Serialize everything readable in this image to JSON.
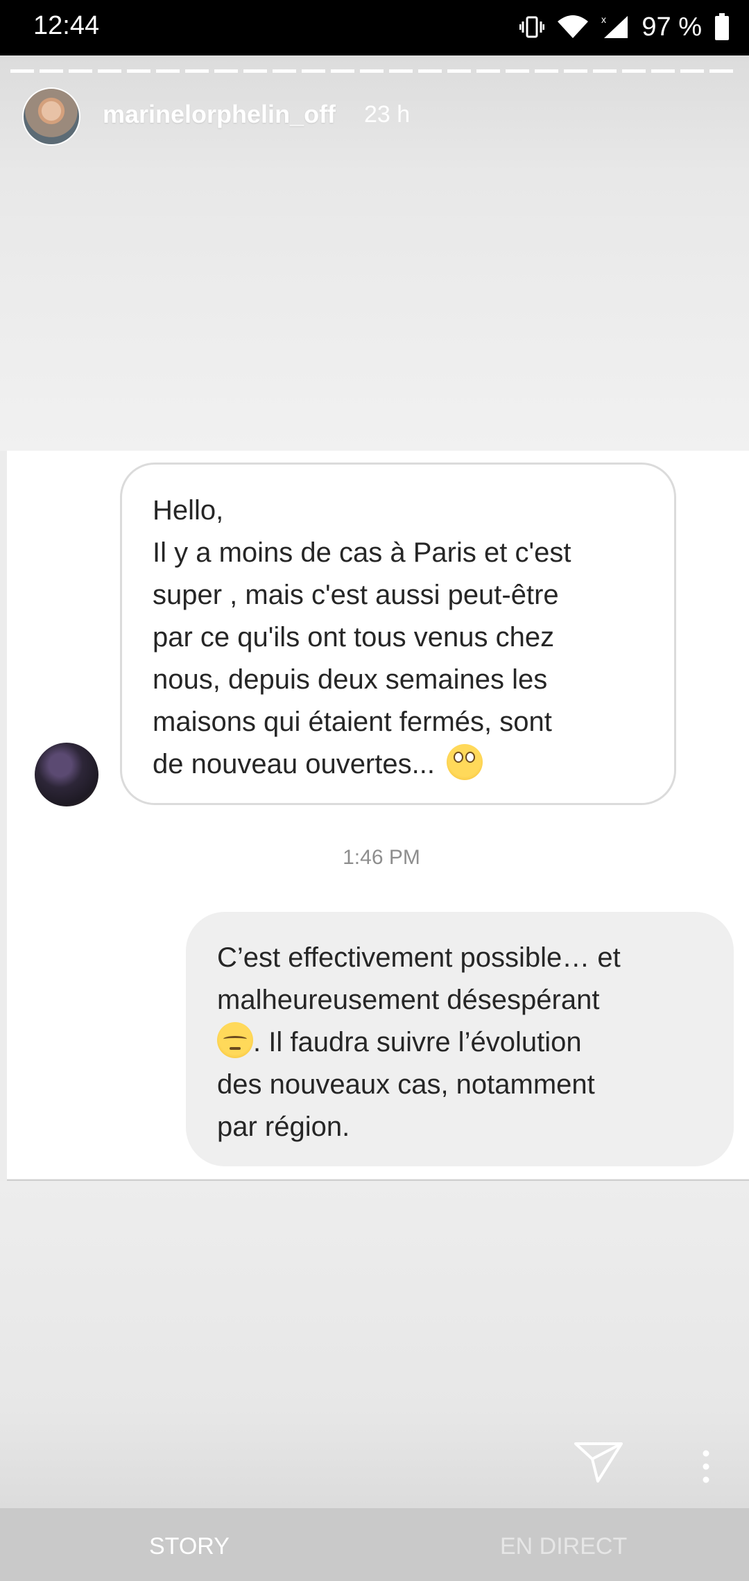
{
  "status_bar": {
    "time": "12:44",
    "battery": "97 %",
    "icons": [
      "vibrate-icon",
      "wifi-icon",
      "signal-icon",
      "battery-icon"
    ]
  },
  "story": {
    "username": "marinelorphelin_off",
    "time_ago": "23 h"
  },
  "conversation": {
    "incoming": {
      "lines": [
        "Hello,",
        "Il y a moins de cas à Paris et c'est",
        "super , mais c'est aussi peut-être",
        "par ce qu'ils ont tous venus chez",
        "nous, depuis deux semaines les",
        "maisons qui étaient fermés, sont",
        "de nouveau ouvertes..."
      ],
      "emoji": "face-with-rolling-eyes-emoji"
    },
    "timestamp": "1:46 PM",
    "outgoing": {
      "lines": [
        "C’est effectivement possible… et",
        "malheureusement désespérant",
        ". Il faudra suivre l’évolution",
        "des nouveaux cas, notamment",
        "par région."
      ],
      "emoji": "pensive-face-emoji"
    }
  },
  "bottom_tabs": {
    "story": "STORY",
    "live": "EN DIRECT"
  }
}
